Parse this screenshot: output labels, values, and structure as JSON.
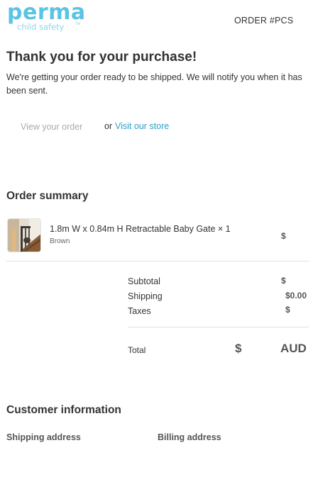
{
  "brand": {
    "name": "perma",
    "tagline": "child safety",
    "trademark": "TM",
    "color": "#5bc3e3"
  },
  "header": {
    "order_label": "ORDER #PCS"
  },
  "thanks": {
    "title": "Thank you for your purchase!",
    "message": "We're getting your order ready to be shipped. We will notify you when it has been sent."
  },
  "actions": {
    "view_order": "View your order",
    "or": "or",
    "visit_store": "Visit our store",
    "link_color": "#2b9fc8"
  },
  "order_summary": {
    "title": "Order summary",
    "items": [
      {
        "name": "1.8m W x 0.84m H Retractable Baby Gate × 1",
        "variant": "Brown",
        "price": "$",
        "thumbnail_icon": "baby-gate-product-photo"
      }
    ],
    "subtotal_label": "Subtotal",
    "subtotal_value": "$",
    "shipping_label": "Shipping",
    "shipping_value": "$0.00",
    "taxes_label": "Taxes",
    "taxes_value": "$",
    "total_label": "Total",
    "total_value": "$",
    "total_currency": "AUD"
  },
  "customer": {
    "title": "Customer information",
    "shipping_address_label": "Shipping address",
    "billing_address_label": "Billing address"
  }
}
